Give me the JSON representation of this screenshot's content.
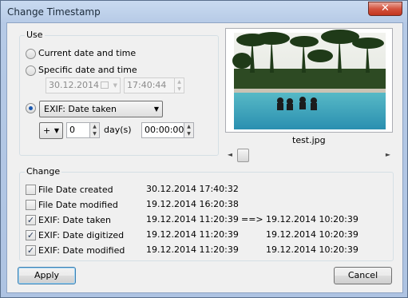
{
  "window": {
    "title": "Change Timestamp",
    "close_glyph": "✕"
  },
  "use_group": {
    "label": "Use",
    "options": {
      "current": "Current date and time",
      "specific": "Specific date and time",
      "exif": "EXIF: Date taken"
    },
    "selected_option": "exif",
    "specific_date": "30.12.2014",
    "specific_time": "17:40:44",
    "offset_sign": "+",
    "offset_days": "0",
    "days_label": "day(s)",
    "offset_time": "00:00:00"
  },
  "preview": {
    "filename": "test.jpg",
    "scroll_position": 0.06
  },
  "change_group": {
    "label": "Change",
    "arrow_label": "==>",
    "rows": [
      {
        "label": "File Date created",
        "checked": false,
        "current": "30.12.2014 17:40:32",
        "arrow": "",
        "new": ""
      },
      {
        "label": "File Date modified",
        "checked": false,
        "current": "19.12.2014 16:20:38",
        "arrow": "",
        "new": ""
      },
      {
        "label": "EXIF: Date taken",
        "checked": true,
        "current": "19.12.2014 11:20:39",
        "arrow": "==>",
        "new": "19.12.2014 10:20:39"
      },
      {
        "label": "EXIF: Date digitized",
        "checked": true,
        "current": "19.12.2014 11:20:39",
        "arrow": "",
        "new": "19.12.2014 10:20:39"
      },
      {
        "label": "EXIF: Date modified",
        "checked": true,
        "current": "19.12.2014 11:20:39",
        "arrow": "",
        "new": "19.12.2014 10:20:39"
      }
    ]
  },
  "buttons": {
    "apply": "Apply",
    "cancel": "Cancel"
  },
  "icons": {
    "check_glyph": "✓",
    "dropdown": "chevron-down-icon",
    "spin_up": "▲",
    "spin_down": "▼",
    "scroll_left": "◄",
    "scroll_right": "►",
    "dropdown_arrow": "▼"
  }
}
